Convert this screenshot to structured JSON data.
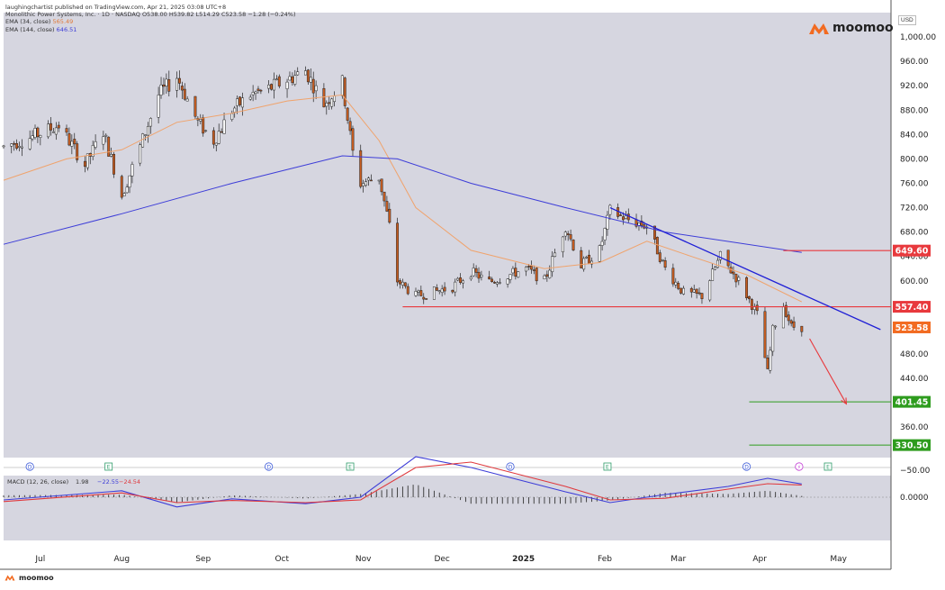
{
  "header": {
    "published_by": "laughingchartist published on TradingView.com, Apr 21, 2025 03:08 UTC+8",
    "instrument_line": "Monolithic Power Systems, Inc. · 1D · NASDAQ  O538.00  H539.82  L514.29  C523.58  −1.28 (−0.24%)",
    "ema34_label": "EMA (34, close)",
    "ema34_value": "565.49",
    "ema144_label": "EMA (144, close)",
    "ema144_value": "646.51"
  },
  "brand": {
    "name": "moomoo",
    "footer_name": "moomoo",
    "color": "#f26b21"
  },
  "colors": {
    "background": "#d6d6e0",
    "up_candle": "#ffffff",
    "down_candle": "#c75d21",
    "ema34": "#f0a36c",
    "ema144": "#3d3dd8",
    "resistance_line": "#e8393d",
    "support_line": "#2e9c1e",
    "trendline": "#1f1fd6",
    "price_badge": "#f26b21"
  },
  "chart_data": [
    {
      "type": "candlestick",
      "title": "Monolithic Power Systems, Inc. · 1D · NASDAQ",
      "y_unit": "USD",
      "ylim": [
        310,
        1040
      ],
      "y_ticks": [
        360,
        400,
        440,
        480,
        520,
        560,
        600,
        640,
        680,
        720,
        760,
        800,
        840,
        880,
        920,
        960,
        1000
      ],
      "y_tick_labels": [
        "360.00",
        "400.00",
        "440.00",
        "480.00",
        "520.00",
        "560.00",
        "600.00",
        "640.00",
        "680.00",
        "720.00",
        "760.00",
        "800.00",
        "840.00",
        "880.00",
        "920.00",
        "960.00",
        "1,000.00"
      ],
      "x_ticks": [
        "Jul",
        "Aug",
        "Sep",
        "Oct",
        "Nov",
        "Dec",
        "2025",
        "Feb",
        "Mar",
        "Apr",
        "May"
      ],
      "price_path": [
        [
          "2024-06-21",
          820
        ],
        [
          "2024-07-01",
          835
        ],
        [
          "2024-07-12",
          855
        ],
        [
          "2024-07-22",
          790
        ],
        [
          "2024-07-29",
          845
        ],
        [
          "2024-08-05",
          740
        ],
        [
          "2024-08-12",
          820
        ],
        [
          "2024-08-19",
          905
        ],
        [
          "2024-08-26",
          935
        ],
        [
          "2024-09-03",
          860
        ],
        [
          "2024-09-09",
          830
        ],
        [
          "2024-09-16",
          880
        ],
        [
          "2024-09-23",
          905
        ],
        [
          "2024-09-30",
          915
        ],
        [
          "2024-10-07",
          930
        ],
        [
          "2024-10-14",
          945
        ],
        [
          "2024-10-21",
          890
        ],
        [
          "2024-10-28",
          925
        ],
        [
          "2024-11-01",
          810
        ],
        [
          "2024-11-04",
          760
        ],
        [
          "2024-11-11",
          770
        ],
        [
          "2024-11-15",
          690
        ],
        [
          "2024-11-18",
          600
        ],
        [
          "2024-11-25",
          575
        ],
        [
          "2024-12-02",
          582
        ],
        [
          "2024-12-09",
          590
        ],
        [
          "2024-12-16",
          615
        ],
        [
          "2024-12-23",
          598
        ],
        [
          "2025-01-06",
          620
        ],
        [
          "2025-01-13",
          600
        ],
        [
          "2025-01-21",
          690
        ],
        [
          "2025-01-27",
          625
        ],
        [
          "2025-02-03",
          650
        ],
        [
          "2025-02-07",
          715
        ],
        [
          "2025-02-14",
          700
        ],
        [
          "2025-02-21",
          690
        ],
        [
          "2025-02-28",
          620
        ],
        [
          "2025-03-07",
          580
        ],
        [
          "2025-03-14",
          575
        ],
        [
          "2025-03-21",
          640
        ],
        [
          "2025-03-28",
          600
        ],
        [
          "2025-04-04",
          545
        ],
        [
          "2025-04-08",
          450
        ],
        [
          "2025-04-10",
          520
        ],
        [
          "2025-04-14",
          560
        ],
        [
          "2025-04-17",
          525
        ],
        [
          "2025-04-21",
          523.58
        ]
      ],
      "ema34_path": [
        [
          "2024-06-21",
          765
        ],
        [
          "2024-07-15",
          800
        ],
        [
          "2024-08-05",
          815
        ],
        [
          "2024-08-26",
          860
        ],
        [
          "2024-09-16",
          875
        ],
        [
          "2024-10-07",
          895
        ],
        [
          "2024-10-28",
          905
        ],
        [
          "2024-11-11",
          830
        ],
        [
          "2024-11-25",
          720
        ],
        [
          "2024-12-16",
          650
        ],
        [
          "2025-01-13",
          620
        ],
        [
          "2025-02-03",
          630
        ],
        [
          "2025-02-21",
          665
        ],
        [
          "2025-03-10",
          640
        ],
        [
          "2025-03-31",
          610
        ],
        [
          "2025-04-21",
          565.49
        ]
      ],
      "ema144_path": [
        [
          "2024-06-21",
          660
        ],
        [
          "2024-08-05",
          710
        ],
        [
          "2024-09-16",
          760
        ],
        [
          "2024-10-28",
          805
        ],
        [
          "2024-11-18",
          800
        ],
        [
          "2024-12-16",
          760
        ],
        [
          "2025-01-21",
          720
        ],
        [
          "2025-02-28",
          680
        ],
        [
          "2025-04-21",
          646.51
        ]
      ],
      "levels": [
        {
          "label": "649.60",
          "value": 649.6,
          "color_key": "resistance"
        },
        {
          "label": "557.40",
          "value": 557.4,
          "color_key": "resistance"
        },
        {
          "label": "523.58",
          "value": 523.58,
          "color_key": "current"
        },
        {
          "label": "401.45",
          "value": 401.45,
          "color_key": "support"
        },
        {
          "label": "330.50",
          "value": 330.5,
          "color_key": "support"
        }
      ],
      "trendline": [
        [
          "2025-02-07",
          720
        ],
        [
          "2025-05-21",
          520
        ]
      ],
      "projection_arrow": [
        [
          "2025-04-24",
          505
        ],
        [
          "2025-05-08",
          398
        ]
      ],
      "event_markers": [
        {
          "date": "2024-07-01",
          "label": "D"
        },
        {
          "date": "2024-07-31",
          "label": "E"
        },
        {
          "date": "2024-09-30",
          "label": "D"
        },
        {
          "date": "2024-10-31",
          "label": "E"
        },
        {
          "date": "2024-12-31",
          "label": "D"
        },
        {
          "date": "2025-02-06",
          "label": "E"
        },
        {
          "date": "2025-03-31",
          "label": "D"
        },
        {
          "date": "2025-04-20",
          "label": "⚡"
        },
        {
          "date": "2025-05-01",
          "label": "E"
        }
      ]
    },
    {
      "type": "line",
      "title": "MACD (12, 26, close)",
      "values_text": [
        "1.98",
        "−22.55",
        "−24.54"
      ],
      "y_ticks": [
        0,
        -50
      ],
      "y_tick_labels": [
        "0.0000",
        "−50.00"
      ],
      "series": [
        {
          "color_key": "macd",
          "x": [
            "2024-06-21",
            "2024-08-05",
            "2024-08-26",
            "2024-09-16",
            "2024-10-14",
            "2024-11-04",
            "2024-11-25",
            "2024-12-16",
            "2025-01-21",
            "2025-02-07",
            "2025-02-28",
            "2025-03-24",
            "2025-04-08",
            "2025-04-21"
          ],
          "values": [
            5,
            -12,
            18,
            3,
            12,
            0,
            -75,
            -55,
            -10,
            10,
            -5,
            -20,
            -35,
            -24.54
          ]
        },
        {
          "color_key": "signal",
          "x": [
            "2024-06-21",
            "2024-08-05",
            "2024-08-26",
            "2024-09-16",
            "2024-10-14",
            "2024-11-04",
            "2024-11-25",
            "2024-12-16",
            "2025-01-21",
            "2025-02-07",
            "2025-02-28",
            "2025-03-24",
            "2025-04-08",
            "2025-04-21"
          ],
          "values": [
            8,
            -8,
            10,
            6,
            10,
            5,
            -55,
            -65,
            -20,
            5,
            2,
            -15,
            -25,
            -22.55
          ]
        }
      ]
    }
  ]
}
